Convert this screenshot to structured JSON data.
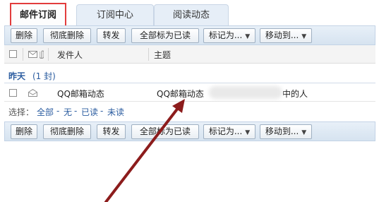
{
  "tabs": {
    "subscription_mail": "邮件订阅",
    "subscription_center": "订阅中心",
    "reading_feed": "阅读动态"
  },
  "toolbar": {
    "delete": "删除",
    "delete_permanently": "彻底删除",
    "forward": "转发",
    "mark_all_read": "全部标为已读",
    "mark_as": "标记为...",
    "move_to": "移动到...",
    "caret": "▼"
  },
  "list_header": {
    "sender": "发件人",
    "subject": "主题"
  },
  "group": {
    "title": "昨天",
    "count": "(1 封)"
  },
  "messages": [
    {
      "sender": "QQ邮箱动态",
      "subject_start": "QQ邮箱动态",
      "subject_end": "中的人"
    }
  ],
  "selection": {
    "label": "选择：",
    "all": "全部",
    "none": "无",
    "read": "已读",
    "unread": "未读",
    "separator": "-"
  },
  "colors": {
    "highlight_box": "#e23c3c",
    "annotation_arrow": "#8c1c1c",
    "link": "#2b5ca0",
    "toolbar_bg": "#dde8f3"
  },
  "icons": {
    "attachment_header": "envelope-icon",
    "row_status": "envelope-open-icon"
  }
}
